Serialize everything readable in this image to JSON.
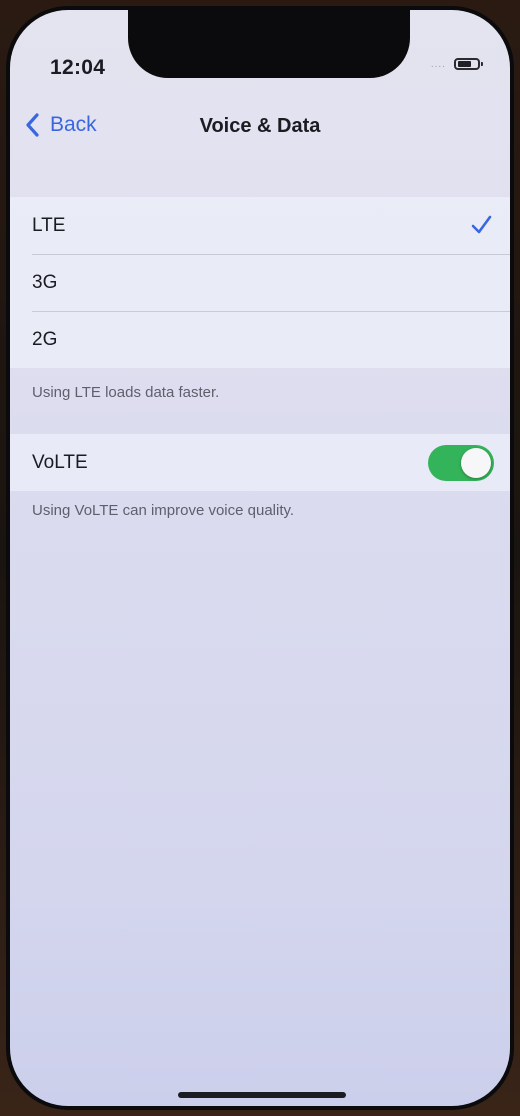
{
  "status_bar": {
    "time": "12:04",
    "signal": "....",
    "battery_icon": "battery-icon"
  },
  "nav": {
    "back_label": "Back",
    "back_icon": "chevron-left-icon",
    "title": "Voice & Data"
  },
  "network_options": [
    {
      "label": "LTE",
      "selected": true
    },
    {
      "label": "3G",
      "selected": false
    },
    {
      "label": "2G",
      "selected": false
    }
  ],
  "network_footer": "Using LTE loads data faster.",
  "volte": {
    "label": "VoLTE",
    "enabled": true,
    "footer": "Using VoLTE can improve voice quality."
  },
  "colors": {
    "accent": "#3a67e0",
    "toggle_on": "#34b45a"
  }
}
